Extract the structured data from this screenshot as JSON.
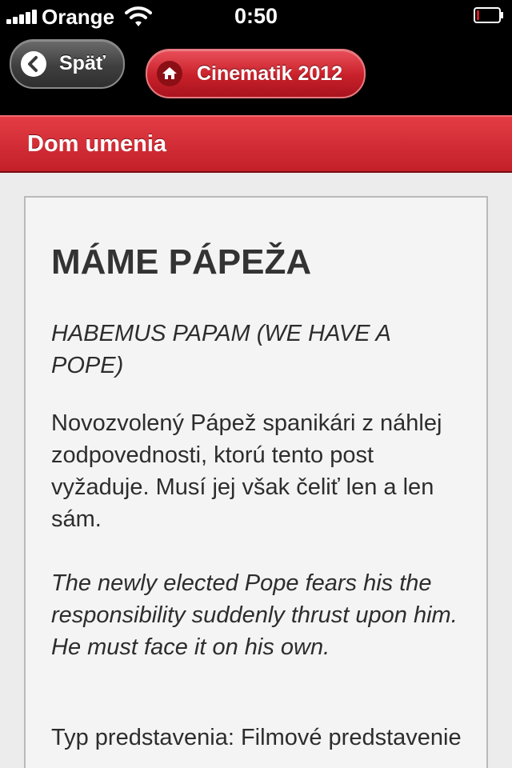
{
  "status_bar": {
    "carrier": "Orange",
    "time": "0:50",
    "signal_bars": 5,
    "battery_level": 0.1,
    "colors": {
      "battery_low": "#d01c24"
    }
  },
  "nav": {
    "back_label": "Späť",
    "back_icon": "chevron-left-icon",
    "home_label": "Cinematik 2012",
    "home_icon": "home-icon"
  },
  "section": {
    "title": "Dom umenia"
  },
  "film": {
    "title": "MÁME PÁPEŽA",
    "original_title": "HABEMUS PAPAM (WE HAVE A POPE)",
    "description_sk": "Novozvolený Pápež spanikári z náhlej zodpovednosti, ktorú tento post vyžaduje. Musí jej však čeliť len a len sám.",
    "description_en": "The newly elected Pope fears his the responsibility suddenly thrust upon him. He must face it on his own.",
    "event_type": "Typ predstavenia: Filmové predstavenie"
  },
  "colors": {
    "accent_red": "#c8202a",
    "nav_background": "#000000",
    "content_background": "#ececec",
    "card_background": "#f4f4f4"
  }
}
